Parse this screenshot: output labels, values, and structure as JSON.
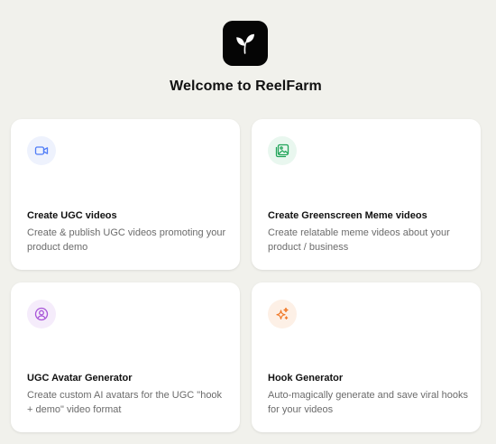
{
  "app": {
    "logo_icon": "sprout-leaf-icon",
    "title": "Welcome to ReelFarm"
  },
  "cards": [
    {
      "title": "Create UGC videos",
      "description": "Create & publish UGC videos promoting your product demo",
      "icon": "video-camera-icon",
      "icon_color": "#4f7cf7",
      "icon_bg": "#eef2fd"
    },
    {
      "title": "Create Greenscreen Meme videos",
      "description": "Create relatable meme videos about your product / business",
      "icon": "image-gallery-icon",
      "icon_color": "#22a55a",
      "icon_bg": "#e9f7ef"
    },
    {
      "title": "UGC Avatar Generator",
      "description": "Create custom AI avatars for the UGC \"hook + demo\" video format",
      "icon": "user-circle-icon",
      "icon_color": "#a855d8",
      "icon_bg": "#f5ecfb"
    },
    {
      "title": "Hook Generator",
      "description": "Auto-magically generate and save viral hooks for your videos",
      "icon": "sparkles-icon",
      "icon_color": "#f07a2a",
      "icon_bg": "#fdf0e6"
    }
  ]
}
